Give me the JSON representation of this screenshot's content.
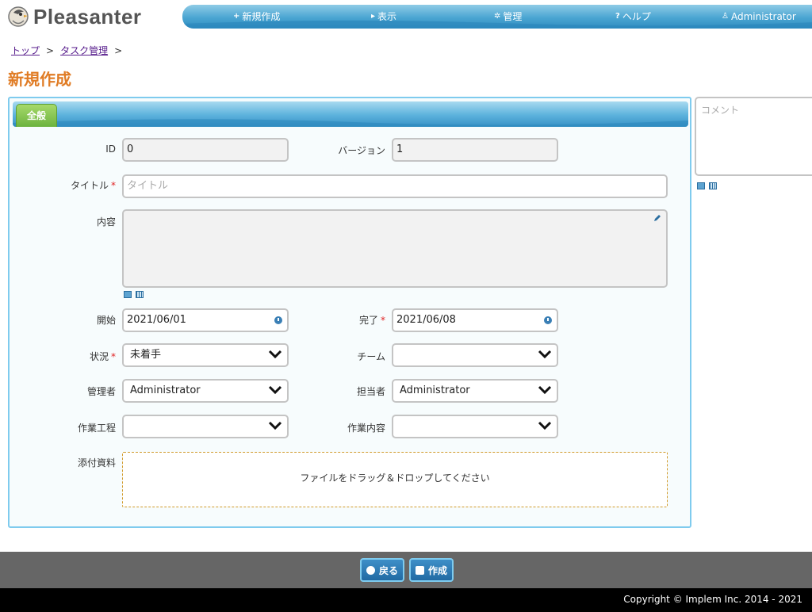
{
  "app": {
    "logo_text": "Pleasanter"
  },
  "nav": {
    "items": [
      {
        "icon": "+",
        "label": "新規作成"
      },
      {
        "icon": "▸",
        "label": "表示"
      },
      {
        "icon": "✲",
        "label": "管理"
      },
      {
        "icon": "?",
        "label": "ヘルプ"
      },
      {
        "icon": "♙",
        "label": "Administrator"
      }
    ]
  },
  "breadcrumb": {
    "items": [
      "トップ",
      "タスク管理"
    ],
    "separator": ">"
  },
  "page": {
    "title": "新規作成"
  },
  "editor": {
    "tab_label": "全般",
    "id_label": "ID",
    "id_value": "0",
    "version_label": "バージョン",
    "version_value": "1",
    "title_label": "タイトル",
    "title_placeholder": "タイトル",
    "body_label": "内容",
    "start_label": "開始",
    "start_value": "2021/06/01",
    "complete_label": "完了",
    "complete_value": "2021/06/08",
    "status_label": "状況",
    "status_value": "未着手",
    "team_label": "チーム",
    "team_value": "",
    "manager_label": "管理者",
    "manager_value": "Administrator",
    "owner_label": "担当者",
    "owner_value": "Administrator",
    "process_label": "作業工程",
    "process_value": "",
    "work_label": "作業内容",
    "work_value": "",
    "attachments_label": "添付資料",
    "dropzone_text": "ファイルをドラッグ＆ドロップしてください",
    "required_mark": "*"
  },
  "comment": {
    "placeholder": "コメント"
  },
  "actions": {
    "back_label": "戻る",
    "create_label": "作成"
  },
  "footer": {
    "copyright": "Copyright © Implem Inc. 2014 - 2021"
  },
  "colors": {
    "accent": "#e07c25",
    "nav_blue": "#4aa5d2",
    "tab_green": "#6cb33f",
    "required": "#e02424"
  }
}
